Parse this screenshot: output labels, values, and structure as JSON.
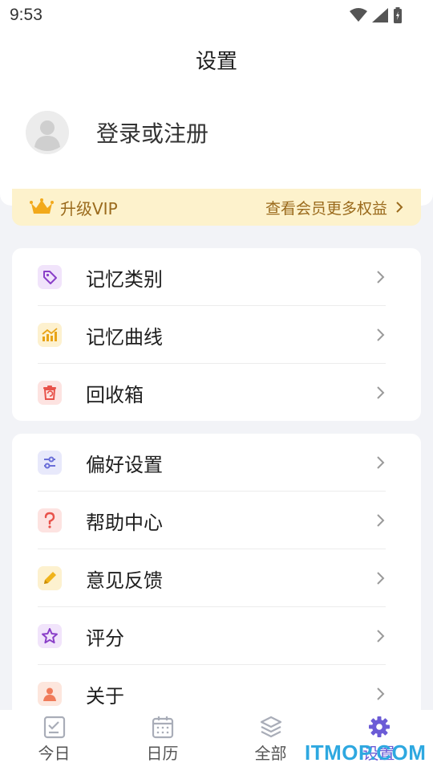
{
  "status_bar": {
    "time": "9:53"
  },
  "header": {
    "title": "设置"
  },
  "user": {
    "login_text": "登录或注册",
    "avatar_icon": "default-avatar-icon"
  },
  "vip": {
    "title": "升级VIP",
    "more": "查看会员更多权益",
    "icon": "crown-icon",
    "color": "#9a6a1c",
    "background": "#fdf2cc"
  },
  "menu_group_1": [
    {
      "label": "记忆类别",
      "icon": "tag-icon",
      "icon_color": "#8a3fc8",
      "icon_bg": "#f1e4fb"
    },
    {
      "label": "记忆曲线",
      "icon": "chart-icon",
      "icon_color": "#e8a317",
      "icon_bg": "#fdf1cf"
    },
    {
      "label": "回收箱",
      "icon": "trash-icon",
      "icon_color": "#e8524a",
      "icon_bg": "#fde3e1"
    }
  ],
  "menu_group_2": [
    {
      "label": "偏好设置",
      "icon": "sliders-icon",
      "icon_color": "#6b6fd8",
      "icon_bg": "#e8e9fb"
    },
    {
      "label": "帮助中心",
      "icon": "question-icon",
      "icon_color": "#e8524a",
      "icon_bg": "#fde3e1"
    },
    {
      "label": "意见反馈",
      "icon": "pencil-icon",
      "icon_color": "#f0b31a",
      "icon_bg": "#fdf1cf"
    },
    {
      "label": "评分",
      "icon": "star-icon",
      "icon_color": "#8a3fc8",
      "icon_bg": "#f1e4fb"
    },
    {
      "label": "关于",
      "icon": "person-icon",
      "icon_color": "#f07b5a",
      "icon_bg": "#fde6dd"
    }
  ],
  "tabbar": {
    "tabs": [
      {
        "label": "今日",
        "icon": "today-icon",
        "active": false
      },
      {
        "label": "日历",
        "icon": "calendar-icon",
        "active": false
      },
      {
        "label": "全部",
        "icon": "layers-icon",
        "active": false
      },
      {
        "label": "设置",
        "icon": "gear-icon",
        "active": true
      }
    ],
    "active_color": "#6b5bd6",
    "inactive_color": "#a9adb8"
  },
  "watermark": {
    "text": "ITMOP.COM"
  }
}
